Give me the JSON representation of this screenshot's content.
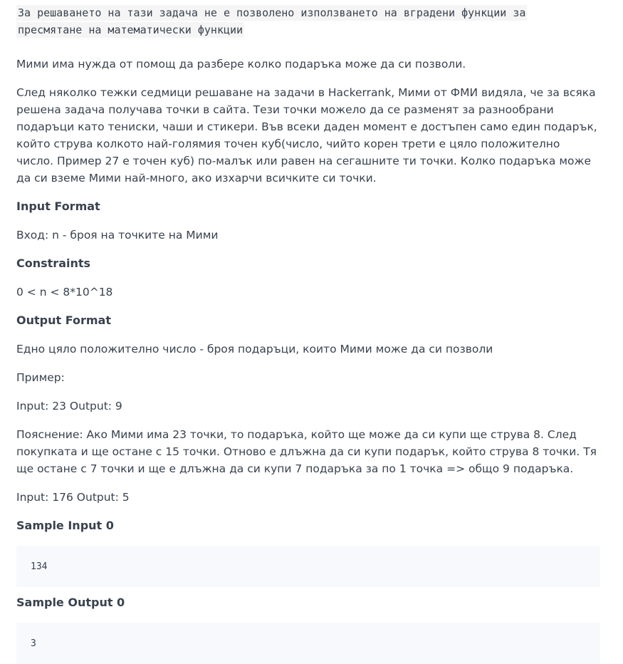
{
  "note": "За решаването на тази задача не е позволено използването на вградени функции за пресмятане на математически функции",
  "intro": "Мими има нужда от помощ да разбере колко подаръка може да си позволи.",
  "story": "След няколко тежки седмици решаване на задачи в Hackerrank, Мими от ФМИ видяла, че за всяка решена задача получава точки в сайта. Тези точки можело да се разменят за разнообрани подаръци като тениски, чаши и стикери. Във всеки даден момент е достъпен само един подарък, който струва колкото най-голямия точен куб(число, чийто корен трети е цяло положително число. Пример 27 е точен куб) по-малък или равен на сегашните ти точки. Колко подаръка може да си вземе Мими най-много, ако изхарчи всичките си точки.",
  "input_format": {
    "heading": "Input Format",
    "text": "Вход: n - броя на точките на Мими"
  },
  "constraints": {
    "heading": "Constraints",
    "text": "0 < n < 8*10^18"
  },
  "output_format": {
    "heading": "Output Format",
    "text": "Едно цяло положително число - броя подаръци, които Мими може да си позволи",
    "example_label": "Пример:",
    "example1": "Input: 23 Output: 9",
    "explanation": "Пояснение: Ако Мими има 23 точки, то подаръка, който ще може да си купи ще струва 8. След покупката и ще остане с 15 точки. Отново е длъжна да си купи подарък, който струва 8 точки. Тя ще остане с 7 точки и ще е длъжна да си купи 7 подаръка за по 1 точка => общо 9 подаръка.",
    "example2": "Input: 176 Output: 5"
  },
  "sample_input": {
    "heading": "Sample Input 0",
    "value": "134"
  },
  "sample_output": {
    "heading": "Sample Output 0",
    "value": "3"
  }
}
